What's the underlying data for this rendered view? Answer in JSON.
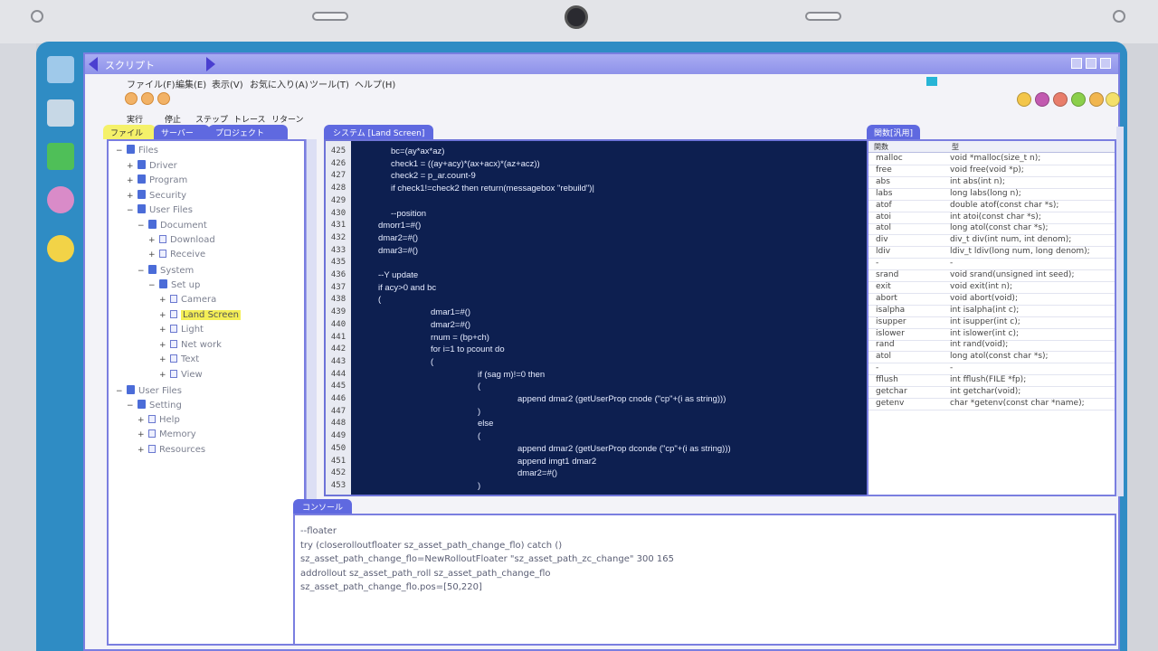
{
  "window": {
    "title": "スクリプト"
  },
  "menu": [
    "ファイル(F)",
    "編集(E)",
    "表示(V)",
    "お気に入り(A)",
    "ツール(T)",
    "ヘルプ(H)"
  ],
  "commands": [
    "実行",
    "停止",
    "ステップ",
    "トレース",
    "リターン"
  ],
  "tree": {
    "tabs": [
      "ファイル",
      "サーバー",
      "プロジェクト"
    ],
    "nodes": [
      {
        "label": "Files",
        "type": "folder",
        "exp": "−",
        "depth": 0
      },
      {
        "label": "Driver",
        "type": "folder",
        "exp": "+",
        "depth": 1
      },
      {
        "label": "Program",
        "type": "folder",
        "exp": "+",
        "depth": 1
      },
      {
        "label": "Security",
        "type": "folder",
        "exp": "+",
        "depth": 1
      },
      {
        "label": "User Files",
        "type": "folder",
        "exp": "−",
        "depth": 1
      },
      {
        "label": "Document",
        "type": "folder",
        "exp": "−",
        "depth": 2
      },
      {
        "label": "Download",
        "type": "file",
        "exp": "+",
        "depth": 3
      },
      {
        "label": "Receive",
        "type": "file",
        "exp": "+",
        "depth": 3
      },
      {
        "label": "System",
        "type": "folder",
        "exp": "−",
        "depth": 2
      },
      {
        "label": "Set up",
        "type": "folder",
        "exp": "−",
        "depth": 3
      },
      {
        "label": "Camera",
        "type": "file",
        "exp": "+",
        "depth": 4
      },
      {
        "label": "Land Screen",
        "type": "file",
        "exp": "+",
        "depth": 4,
        "selected": true
      },
      {
        "label": "Light",
        "type": "file",
        "exp": "+",
        "depth": 4
      },
      {
        "label": "Net work",
        "type": "file",
        "exp": "+",
        "depth": 4
      },
      {
        "label": "Text",
        "type": "file",
        "exp": "+",
        "depth": 4
      },
      {
        "label": "View",
        "type": "file",
        "exp": "+",
        "depth": 4
      },
      {
        "label": "User Files",
        "type": "folder",
        "exp": "−",
        "depth": 0
      },
      {
        "label": "Setting",
        "type": "folder",
        "exp": "−",
        "depth": 1
      },
      {
        "label": "Help",
        "type": "file",
        "exp": "+",
        "depth": 2
      },
      {
        "label": "Memory",
        "type": "file",
        "exp": "+",
        "depth": 2
      },
      {
        "label": "Resources",
        "type": "file",
        "exp": "+",
        "depth": 2
      }
    ]
  },
  "editor": {
    "tab": "システム [Land Screen]",
    "lines": [
      {
        "n": "425",
        "t": "bc=(ay*ax*az)",
        "i": 1
      },
      {
        "n": "426",
        "t": "check1 = ((ay+acy)*(ax+acx)*(az+acz))",
        "i": 1
      },
      {
        "n": "427",
        "t": "check2 = p_ar.count-9",
        "i": 1
      },
      {
        "n": "428",
        "t": "if check1!=check2 then return(messagebox \"rebuild\")|",
        "i": 1
      },
      {
        "n": "429",
        "t": "",
        "i": 0
      },
      {
        "n": "430",
        "t": "--position",
        "i": 1
      },
      {
        "n": "431",
        "t": "dmorr1=#()",
        "i": 0
      },
      {
        "n": "432",
        "t": "dmar2=#()",
        "i": 0
      },
      {
        "n": "433",
        "t": "dmar3=#()",
        "i": 0
      },
      {
        "n": "435",
        "t": "",
        "i": 0
      },
      {
        "n": "436",
        "t": "--Y update",
        "i": 0
      },
      {
        "n": "437",
        "t": "if acy>0 and bc",
        "i": 0
      },
      {
        "n": "438",
        "t": "(",
        "i": 0
      },
      {
        "n": "439",
        "t": "dmar1=#()",
        "i": 2
      },
      {
        "n": "440",
        "t": "dmar2=#()",
        "i": 2
      },
      {
        "n": "441",
        "t": "rnum = (bp+ch)",
        "i": 2
      },
      {
        "n": "442",
        "t": "for i=1 to pcount do",
        "i": 2
      },
      {
        "n": "443",
        "t": "(",
        "i": 2
      },
      {
        "n": "444",
        "t": "if (sag m)!=0 then",
        "i": 3
      },
      {
        "n": "445",
        "t": "(",
        "i": 3
      },
      {
        "n": "446",
        "t": "append dmar2 (getUserProp cnode (\"cp\"+(i as string)))",
        "i": 4
      },
      {
        "n": "447",
        "t": ")",
        "i": 3
      },
      {
        "n": "448",
        "t": "else",
        "i": 3
      },
      {
        "n": "449",
        "t": "(",
        "i": 3
      },
      {
        "n": "450",
        "t": "append dmar2 (getUserProp dconde (\"cp\"+(i as string)))",
        "i": 4
      },
      {
        "n": "451",
        "t": "append imgt1 dmar2",
        "i": 4
      },
      {
        "n": "452",
        "t": "dmar2=#()",
        "i": 4
      },
      {
        "n": "453",
        "t": ")",
        "i": 3
      }
    ]
  },
  "functions": {
    "tab": "関数[汎用]",
    "headers": [
      "関数",
      "型"
    ],
    "rows": [
      {
        "name": "malloc",
        "sig": "void *malloc(size_t n);"
      },
      {
        "name": "free",
        "sig": "void free(void *p);"
      },
      {
        "name": "abs",
        "sig": "int abs(int n);"
      },
      {
        "name": "labs",
        "sig": "long labs(long n);"
      },
      {
        "name": "atof",
        "sig": "double atof(const char *s);"
      },
      {
        "name": "atoi",
        "sig": "int atoi(const char *s);"
      },
      {
        "name": "atol",
        "sig": "long atol(const char *s);"
      },
      {
        "name": "div",
        "sig": "div_t div(int num, int denom);"
      },
      {
        "name": "ldiv",
        "sig": "ldiv_t ldiv(long num, long denom);"
      },
      {
        "name": "-",
        "sig": "-"
      },
      {
        "name": "srand",
        "sig": "void srand(unsigned int seed);"
      },
      {
        "name": "exit",
        "sig": "void exit(int n);"
      },
      {
        "name": "abort",
        "sig": "void abort(void);"
      },
      {
        "name": "isalpha",
        "sig": "int isalpha(int c);"
      },
      {
        "name": "isupper",
        "sig": "int isupper(int c);"
      },
      {
        "name": "islower",
        "sig": "int islower(int c);"
      },
      {
        "name": "rand",
        "sig": "int rand(void);"
      },
      {
        "name": "atol",
        "sig": "long atol(const char *s);"
      },
      {
        "name": "-",
        "sig": "-"
      },
      {
        "name": "fflush",
        "sig": "int fflush(FILE *fp);"
      },
      {
        "name": "getchar",
        "sig": "int getchar(void);"
      },
      {
        "name": "getenv",
        "sig": "char *getenv(const char *name);"
      }
    ]
  },
  "console": {
    "tab": "コンソール",
    "lines": [
      "--floater",
      "try (closerolloutfloater sz_asset_path_change_flo) catch ()",
      "sz_asset_path_change_flo=NewRolloutFloater \"sz_asset_path_zc_change\" 300 165",
      "addrollout sz_asset_path_roll sz_asset_path_change_flo",
      "sz_asset_path_change_flo.pos=[50,220]"
    ]
  },
  "colors": {
    "editor_bg": "#0d1f50",
    "accent": "#5f69e0",
    "highlight": "#f4ee56"
  }
}
